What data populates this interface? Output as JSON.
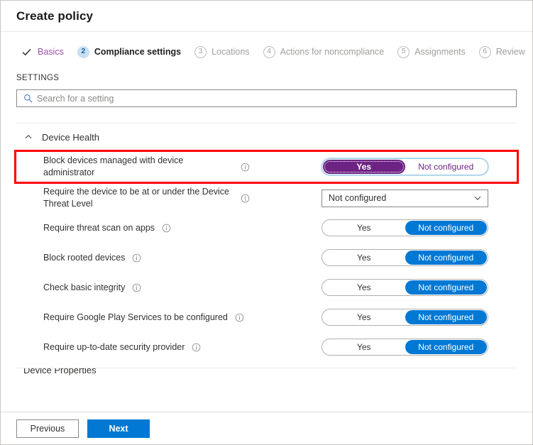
{
  "window": {
    "title": "Create policy"
  },
  "wizard": {
    "steps": [
      {
        "badge": "✓",
        "label": "Basics",
        "state": "done"
      },
      {
        "badge": "2",
        "label": "Compliance settings",
        "state": "current"
      },
      {
        "badge": "3",
        "label": "Locations",
        "state": "pending"
      },
      {
        "badge": "4",
        "label": "Actions for noncompliance",
        "state": "pending"
      },
      {
        "badge": "5",
        "label": "Assignments",
        "state": "pending"
      },
      {
        "badge": "6",
        "label": "Review",
        "state": "pending"
      }
    ]
  },
  "settings": {
    "heading": "SETTINGS",
    "search": {
      "placeholder": "Search for a setting",
      "value": "",
      "icon": "search-icon"
    },
    "section": {
      "title": "Device Health",
      "expanded_icon": "chevron-up-icon"
    },
    "next_section_peek": {
      "title": "Device Properties"
    },
    "rows": [
      {
        "label": "Block devices managed with device administrator",
        "info_icon": "info-icon",
        "control": "pill",
        "options": [
          "Yes",
          "Not configured"
        ],
        "selected": "Yes",
        "accent": "#6d2383",
        "highlighted": true,
        "focused": true
      },
      {
        "label": "Require the device to be at or under the Device Threat Level",
        "info_icon": "info-icon",
        "control": "dropdown",
        "value": "Not configured",
        "highlighted": false
      },
      {
        "label": "Require threat scan on apps",
        "info_icon": "info-icon",
        "control": "pill",
        "options": [
          "Yes",
          "Not configured"
        ],
        "selected": "Not configured",
        "accent": "#0078d4",
        "highlighted": false
      },
      {
        "label": "Block rooted devices",
        "info_icon": "info-icon",
        "control": "pill",
        "options": [
          "Yes",
          "Not configured"
        ],
        "selected": "Not configured",
        "accent": "#0078d4",
        "highlighted": false
      },
      {
        "label": "Check basic integrity",
        "info_icon": "info-icon",
        "control": "pill",
        "options": [
          "Yes",
          "Not configured"
        ],
        "selected": "Not configured",
        "accent": "#0078d4",
        "highlighted": false
      },
      {
        "label": "Require Google Play Services to be configured",
        "info_icon": "info-icon",
        "control": "pill",
        "options": [
          "Yes",
          "Not configured"
        ],
        "selected": "Not configured",
        "accent": "#0078d4",
        "highlighted": false
      },
      {
        "label": "Require up-to-date security provider",
        "info_icon": "info-icon",
        "control": "pill",
        "options": [
          "Yes",
          "Not configured"
        ],
        "selected": "Not configured",
        "accent": "#0078d4",
        "highlighted": false
      }
    ]
  },
  "footer": {
    "previous_label": "Previous",
    "next_label": "Next"
  },
  "colors": {
    "accent_blue": "#0078d4",
    "accent_purple": "#6d2383",
    "link_purple": "#9b51a8",
    "highlight_red": "#ff0000",
    "step_current_badge_bg": "#c7e0f4"
  }
}
